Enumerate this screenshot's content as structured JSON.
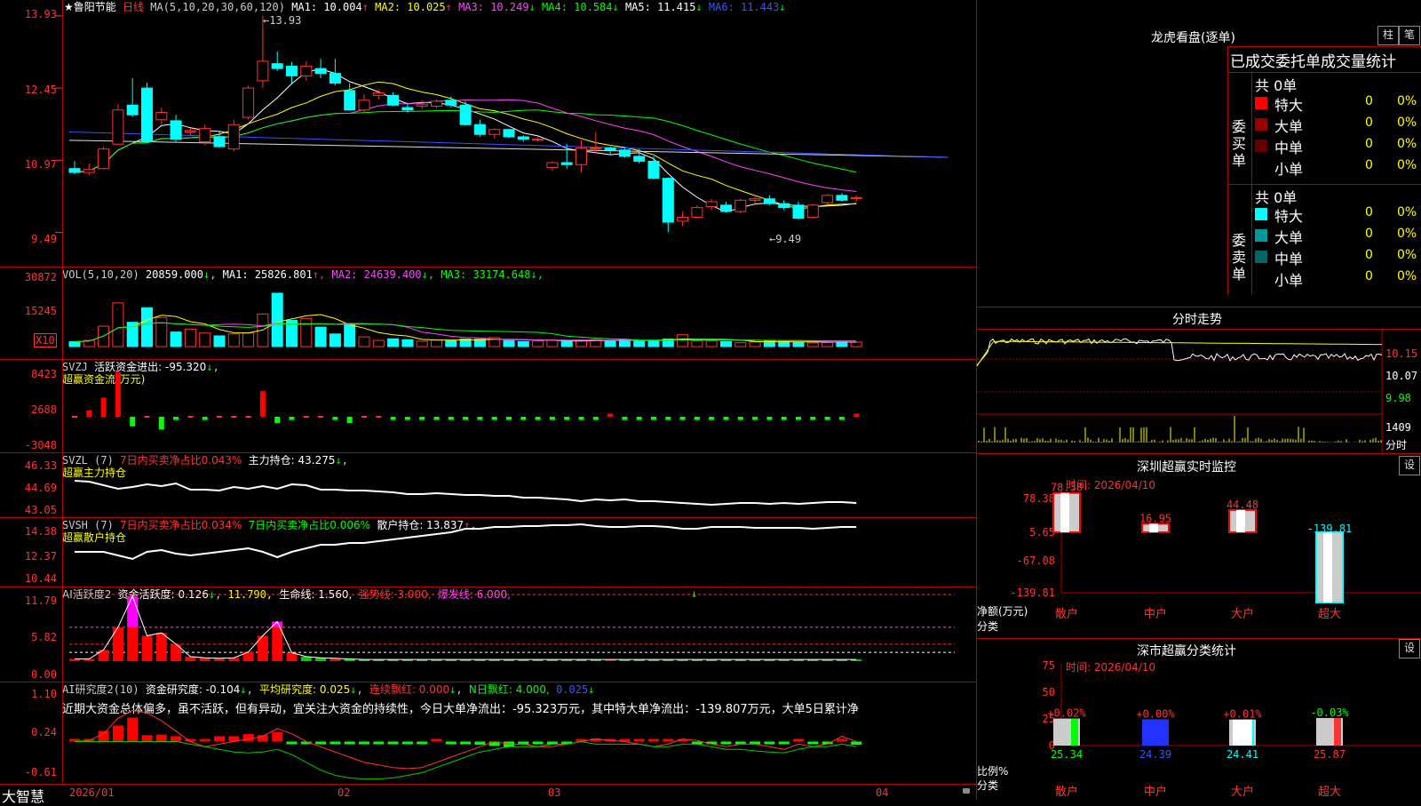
{
  "main": {
    "stock_name": "★鲁阳节能",
    "period": "日线",
    "ma_label": "MA(5,10,20,30,60,120)",
    "mas": [
      {
        "label": "MA1: 10.004",
        "arrow": "↑",
        "color": "#ffffff"
      },
      {
        "label": "MA2: 10.025",
        "arrow": "↑",
        "color": "#ffff00"
      },
      {
        "label": "MA3: 10.249",
        "arrow": "↓",
        "color": "#ff44ff"
      },
      {
        "label": "MA4: 10.584",
        "arrow": "↓",
        "color": "#00ff00"
      },
      {
        "label": "MA5: 11.415",
        "arrow": "↓",
        "color": "#ffffff"
      },
      {
        "label": "MA6: 11.443",
        "arrow": "↓",
        "color": "#3355ff"
      }
    ],
    "y_ticks": [
      "13.93",
      "12.45",
      "10.97",
      "9.49"
    ],
    "high_label": "13.93",
    "low_label": "9.49"
  },
  "chart_data": [
    {
      "type": "candlestick",
      "title": "鲁阳节能 日线",
      "ylim": [
        9.3,
        14.0
      ],
      "rise_color": "#ff3333",
      "fall_color": "#00ffff",
      "candles": [
        {
          "o": 10.8,
          "h": 10.95,
          "l": 10.68,
          "c": 10.72
        },
        {
          "o": 10.72,
          "h": 10.9,
          "l": 10.66,
          "c": 10.78
        },
        {
          "o": 10.8,
          "h": 11.25,
          "l": 10.78,
          "c": 11.2
        },
        {
          "o": 11.3,
          "h": 12.12,
          "l": 11.28,
          "c": 12.0
        },
        {
          "o": 12.1,
          "h": 12.65,
          "l": 11.85,
          "c": 11.9
        },
        {
          "o": 12.45,
          "h": 12.56,
          "l": 11.35,
          "c": 11.35
        },
        {
          "o": 11.8,
          "h": 12.05,
          "l": 11.7,
          "c": 11.95
        },
        {
          "o": 11.78,
          "h": 11.9,
          "l": 11.35,
          "c": 11.4
        },
        {
          "o": 11.55,
          "h": 11.62,
          "l": 11.48,
          "c": 11.58
        },
        {
          "o": 11.35,
          "h": 11.7,
          "l": 11.28,
          "c": 11.62
        },
        {
          "o": 11.45,
          "h": 11.55,
          "l": 11.22,
          "c": 11.25
        },
        {
          "o": 11.2,
          "h": 11.8,
          "l": 11.15,
          "c": 11.7
        },
        {
          "o": 11.85,
          "h": 12.5,
          "l": 11.8,
          "c": 12.45
        },
        {
          "o": 12.6,
          "h": 13.93,
          "l": 12.45,
          "c": 13.0
        },
        {
          "o": 12.95,
          "h": 13.2,
          "l": 12.8,
          "c": 12.85
        },
        {
          "o": 12.9,
          "h": 12.98,
          "l": 12.55,
          "c": 12.7
        },
        {
          "o": 12.7,
          "h": 13.0,
          "l": 12.6,
          "c": 12.9
        },
        {
          "o": 12.85,
          "h": 13.05,
          "l": 12.65,
          "c": 12.75
        },
        {
          "o": 12.75,
          "h": 13.05,
          "l": 12.5,
          "c": 12.55
        },
        {
          "o": 12.4,
          "h": 12.55,
          "l": 11.98,
          "c": 12.0
        },
        {
          "o": 12.0,
          "h": 12.32,
          "l": 11.95,
          "c": 12.2
        },
        {
          "o": 12.3,
          "h": 12.42,
          "l": 12.22,
          "c": 12.35
        },
        {
          "o": 12.3,
          "h": 12.36,
          "l": 12.08,
          "c": 12.1
        },
        {
          "o": 12.05,
          "h": 12.15,
          "l": 11.95,
          "c": 12.0
        },
        {
          "o": 12.08,
          "h": 12.2,
          "l": 12.02,
          "c": 12.12
        },
        {
          "o": 12.08,
          "h": 12.22,
          "l": 12.04,
          "c": 12.18
        },
        {
          "o": 12.2,
          "h": 12.28,
          "l": 12.05,
          "c": 12.1
        },
        {
          "o": 12.1,
          "h": 12.18,
          "l": 11.68,
          "c": 11.7
        },
        {
          "o": 11.7,
          "h": 11.8,
          "l": 11.45,
          "c": 11.5
        },
        {
          "o": 11.5,
          "h": 11.62,
          "l": 11.42,
          "c": 11.6
        },
        {
          "o": 11.6,
          "h": 11.62,
          "l": 11.42,
          "c": 11.45
        },
        {
          "o": 11.45,
          "h": 11.48,
          "l": 11.35,
          "c": 11.4
        },
        {
          "o": 11.4,
          "h": 11.45,
          "l": 11.35,
          "c": 11.4
        },
        {
          "o": 10.82,
          "h": 10.95,
          "l": 10.75,
          "c": 10.92
        },
        {
          "o": 10.92,
          "h": 11.3,
          "l": 10.8,
          "c": 10.88
        },
        {
          "o": 10.88,
          "h": 11.38,
          "l": 10.72,
          "c": 11.22
        },
        {
          "o": 11.2,
          "h": 11.55,
          "l": 11.1,
          "c": 11.22
        },
        {
          "o": 11.22,
          "h": 11.25,
          "l": 11.08,
          "c": 11.18
        },
        {
          "o": 11.18,
          "h": 11.22,
          "l": 11.02,
          "c": 11.05
        },
        {
          "o": 11.05,
          "h": 11.2,
          "l": 10.9,
          "c": 10.95
        },
        {
          "o": 10.95,
          "h": 11.05,
          "l": 10.58,
          "c": 10.6
        },
        {
          "o": 10.6,
          "h": 10.62,
          "l": 9.49,
          "c": 9.7
        },
        {
          "o": 9.72,
          "h": 9.92,
          "l": 9.62,
          "c": 9.8
        },
        {
          "o": 9.8,
          "h": 10.05,
          "l": 9.78,
          "c": 10.0
        },
        {
          "o": 10.02,
          "h": 10.18,
          "l": 9.95,
          "c": 10.12
        },
        {
          "o": 10.05,
          "h": 10.12,
          "l": 9.9,
          "c": 9.92
        },
        {
          "o": 9.92,
          "h": 10.18,
          "l": 9.88,
          "c": 10.15
        },
        {
          "o": 10.15,
          "h": 10.25,
          "l": 10.05,
          "c": 10.18
        },
        {
          "o": 10.18,
          "h": 10.25,
          "l": 10.05,
          "c": 10.08
        },
        {
          "o": 10.08,
          "h": 10.15,
          "l": 9.95,
          "c": 10.0
        },
        {
          "o": 10.05,
          "h": 10.12,
          "l": 9.75,
          "c": 9.78
        },
        {
          "o": 9.8,
          "h": 10.08,
          "l": 9.78,
          "c": 10.05
        },
        {
          "o": 10.1,
          "h": 10.28,
          "l": 10.05,
          "c": 10.25
        },
        {
          "o": 10.25,
          "h": 10.3,
          "l": 10.12,
          "c": 10.15
        },
        {
          "o": 10.18,
          "h": 10.25,
          "l": 10.12,
          "c": 10.2
        }
      ]
    },
    {
      "type": "bar",
      "title": "VOL(5,10,20)",
      "ylim": [
        0,
        38000
      ],
      "y_ticks": [
        "30872",
        "15245",
        "X10"
      ],
      "values": [
        2500,
        3200,
        10500,
        22500,
        12500,
        20000,
        15000,
        7500,
        9000,
        7000,
        5500,
        6500,
        7000,
        16800,
        27500,
        13500,
        14500,
        10000,
        6500,
        11500,
        5000,
        3200,
        4000,
        3500,
        2800,
        3400,
        3200,
        3900,
        3800,
        4600,
        3100,
        2600,
        2900,
        3300,
        2500,
        3200,
        3600,
        2900,
        3600,
        2800,
        3200,
        3900,
        6100,
        3000,
        2900,
        2600,
        2000,
        2400,
        2800,
        2600,
        2300,
        1900,
        2100,
        2600,
        2300
      ]
    },
    {
      "type": "bar",
      "title": "SVZJ 超赢资金流(万元)",
      "ylim": [
        -3200,
        8800
      ],
      "y_ticks": [
        "8423",
        "2688",
        "-3048"
      ]
    },
    {
      "type": "line",
      "title": "SVZL 超赢主力持仓",
      "ylim": [
        43.05,
        46.33
      ],
      "y_ticks": [
        "46.33",
        "44.69",
        "43.05"
      ]
    },
    {
      "type": "line",
      "title": "SVSH 超赢散户持仓",
      "ylim": [
        10.44,
        14.38
      ],
      "y_ticks": [
        "14.38",
        "12.37",
        "10.44"
      ]
    },
    {
      "type": "bar",
      "title": "AI活跃度2",
      "ylim": [
        0,
        11.79
      ],
      "y_ticks": [
        "11.79",
        "5.82",
        "0.00"
      ]
    },
    {
      "type": "bar",
      "title": "AI研究度2(10)",
      "ylim": [
        -0.61,
        1.1
      ],
      "y_ticks": [
        "1.10",
        "0.24",
        "-0.61"
      ]
    },
    {
      "type": "bar",
      "title": "深圳超赢实时监控",
      "categories": [
        "散户",
        "中户",
        "大户",
        "超大"
      ],
      "values": [
        78.38,
        16.95,
        44.48,
        -139.81
      ],
      "y_ticks": [
        "78.38",
        "5.65",
        "-67.08",
        "-139.81"
      ]
    },
    {
      "type": "bar",
      "title": "深市超赢分类统计",
      "categories": [
        "散户",
        "中户",
        "大户",
        "超大"
      ],
      "values": [
        25.34,
        24.39,
        24.41,
        25.87
      ],
      "change_labels": [
        "+0.02%",
        "+0.00%",
        "+0.01%",
        "-0.03%"
      ],
      "y_ticks": [
        "75",
        "50",
        "25",
        "0"
      ]
    }
  ],
  "volume": {
    "label": "VOL(5,10,20)",
    "value": "20859.000",
    "arrow1": "↓",
    "mas": [
      {
        "label": "MA1: 25826.801",
        "arrow": "↑",
        "color": "#ffffff"
      },
      {
        "label": "MA2: 24639.400",
        "arrow": "↓",
        "color": "#ff44ff"
      },
      {
        "label": "MA3: 33174.648",
        "arrow": "↓",
        "color": "#00ff00"
      }
    ]
  },
  "svzj": {
    "name": "SVZJ",
    "label": "活跃资金进出: -95.320",
    "arrow": "↓",
    "sub": "超赢资金流(万元)"
  },
  "svzl": {
    "name": "SVZL (7)",
    "l1": "7日内买卖净占比0.043%",
    "l2": "主力持仓: 43.275",
    "arrow": "↓",
    "sub": "超赢主力持仓"
  },
  "svsh": {
    "name": "SVSH (7)",
    "l1": "7日内买卖净占比0.034%",
    "l2": "7日内买卖净占比0.006%",
    "l3": "散户持仓: 13.837",
    "arrow": "↑",
    "sub": "超赢散户持仓"
  },
  "ai1": {
    "name": "AI活跃度2",
    "l1": "资金活跃度: 0.126",
    "a1": "↓",
    "l2": "11.790,",
    "l3": "生命线: 1.560,",
    "l4": "强势线: 3.000,",
    "l5": "爆发线: 6.000,"
  },
  "ai2": {
    "name": "AI研究度2(10)",
    "l1": "资金研究度: -0.104",
    "a1": "↓",
    "l2": "平均研究度: 0.025",
    "a2": "↓",
    "l3": "连续飘红: 0.000",
    "a3": "↓",
    "l4": "N日飘红: 4.000,",
    "l5": "0.025",
    "a5": "↓",
    "note": "近期大资金总体偏多，虽不活跃，但有异动，宜关注大资金的持续性，今日大单净流出：-95.323万元，其中特大单净流出：-139.807万元，大单5日累计净"
  },
  "x_axis": [
    "2026/01",
    "02",
    "03",
    "04"
  ],
  "brand": "大智慧",
  "longhu": {
    "title": "龙虎看盘(逐单)",
    "btn_zhu": "柱",
    "btn_bi": "笔",
    "table_title": "已成交委托单成交量统计",
    "buy_label": "委买单",
    "sell_label": "委卖单",
    "buy_total": "共 0单",
    "sell_total": "共 0单",
    "buy_rows": [
      {
        "name": "特大",
        "vol": "0",
        "pct": "0%",
        "color": "#ff0000"
      },
      {
        "name": "大单",
        "vol": "0",
        "pct": "0%",
        "color": "#990000"
      },
      {
        "name": "中单",
        "vol": "0",
        "pct": "0%",
        "color": "#660000"
      },
      {
        "name": "小单",
        "vol": "0",
        "pct": "0%",
        "color": "#000000"
      }
    ],
    "sell_rows": [
      {
        "name": "特大",
        "vol": "0",
        "pct": "0%",
        "color": "#00ffff"
      },
      {
        "name": "大单",
        "vol": "0",
        "pct": "0%",
        "color": "#009999"
      },
      {
        "name": "中单",
        "vol": "0",
        "pct": "0%",
        "color": "#006666"
      },
      {
        "name": "小单",
        "vol": "0",
        "pct": "0%",
        "color": "#000000"
      }
    ]
  },
  "intraday": {
    "title": "分时走势",
    "ticks": [
      "10.15",
      "10.07",
      "9.98"
    ],
    "vol_tick": "1409",
    "vol_label": "分时"
  },
  "sz_monitor": {
    "title": "深圳超赢实时监控",
    "btn": "设",
    "time": "时间: 2026/04/10",
    "ylabel": "净额(万元)",
    "xlabel": "分类",
    "values": [
      "78.38",
      "16.95",
      "44.48",
      "-139.81"
    ],
    "cats": [
      "散户",
      "中户",
      "大户",
      "超大"
    ]
  },
  "sz_class": {
    "title": "深市超赢分类统计",
    "btn": "设",
    "time": "时间: 2026/04/10",
    "ylabel": "比例%",
    "xlabel": "分类",
    "changes": [
      "+0.02%",
      "+0.00%",
      "+0.01%",
      "-0.03%"
    ],
    "values": [
      "25.34",
      "24.39",
      "24.41",
      "25.87"
    ],
    "cats": [
      "散户",
      "中户",
      "大户",
      "超大"
    ]
  }
}
